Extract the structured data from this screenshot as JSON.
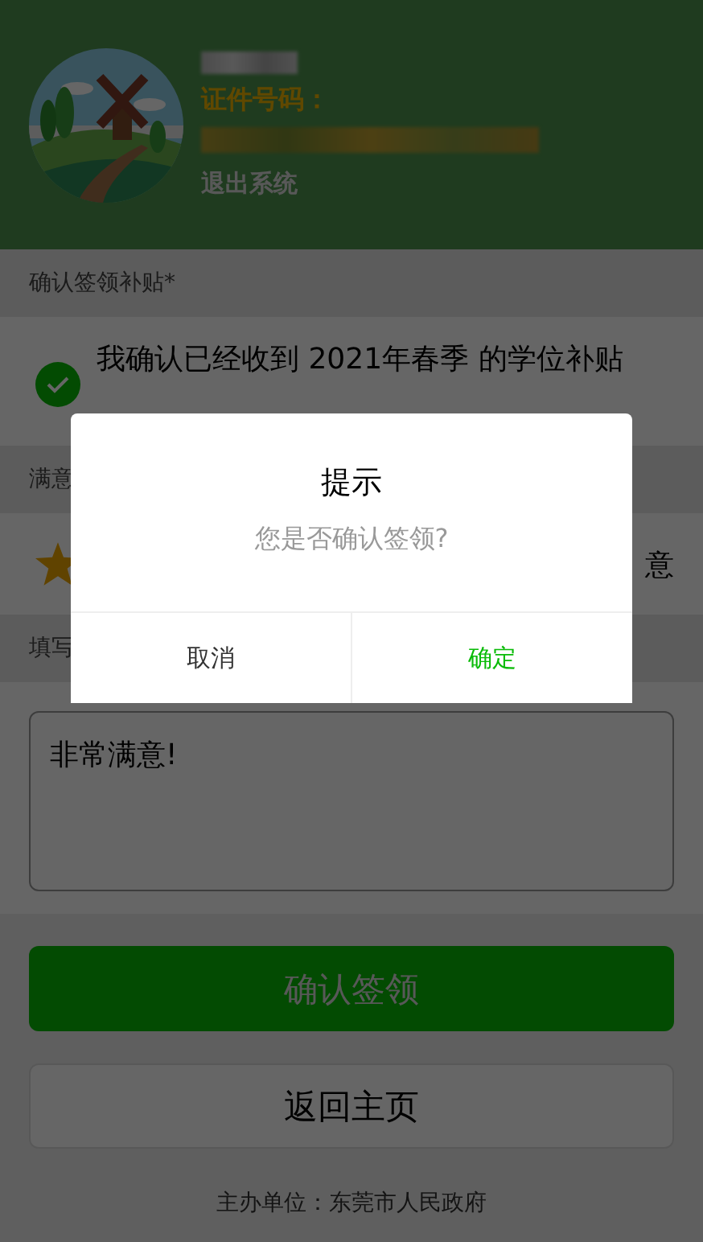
{
  "profile": {
    "id_label": "证件号码：",
    "logout": "退出系统"
  },
  "sections": [
    {
      "kind": "check",
      "label": "确认签领补贴*",
      "text": "我确认已经收到 2021年春季 的学位补贴",
      "checked": true
    },
    {
      "kind": "rating",
      "label": "满意",
      "trailing": "意"
    },
    {
      "kind": "textarea",
      "label": "填写",
      "value": "非常满意!"
    }
  ],
  "buttons": [
    {
      "kind": "primary",
      "label": "确认签领"
    },
    {
      "kind": "default",
      "label": "返回主页"
    }
  ],
  "footer": "主办单位：东莞市人民政府",
  "dialog": {
    "title": "提示",
    "message": "您是否确认签领?",
    "buttons": [
      {
        "label": "取消",
        "kind": "cancel"
      },
      {
        "label": "确定",
        "kind": "confirm"
      }
    ]
  }
}
